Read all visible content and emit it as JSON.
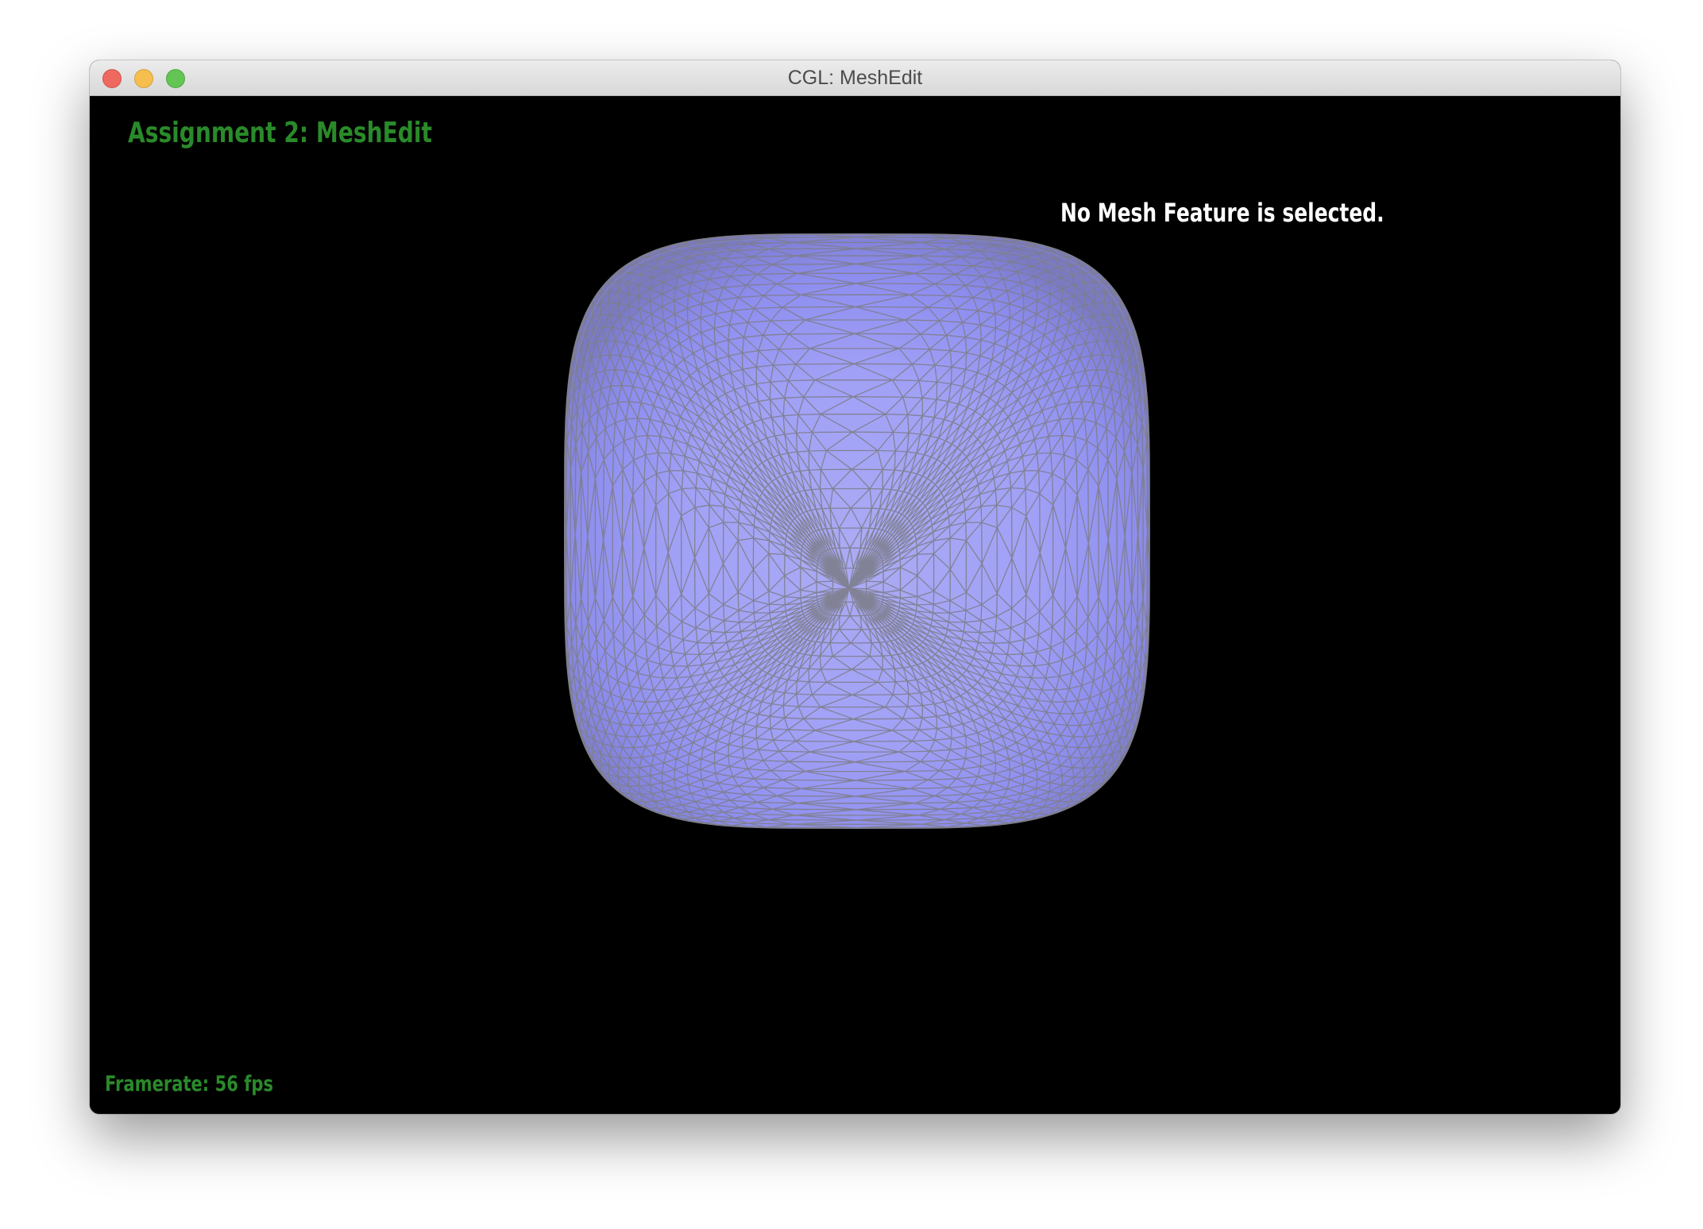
{
  "window": {
    "title": "CGL: MeshEdit"
  },
  "viewport": {
    "assignment_title": "Assignment 2: MeshEdit",
    "selection_status": "No Mesh Feature is selected.",
    "framerate_label": "Framerate:",
    "framerate_value": "56 fps"
  },
  "colors": {
    "hud_green": "#2a8a2a",
    "mesh_fill": "#a3a3f7",
    "mesh_wire": "#808090",
    "background": "#000000"
  },
  "icons": {
    "close": "traffic-light-close-icon",
    "minimize": "traffic-light-minimize-icon",
    "zoom": "traffic-light-zoom-icon"
  }
}
